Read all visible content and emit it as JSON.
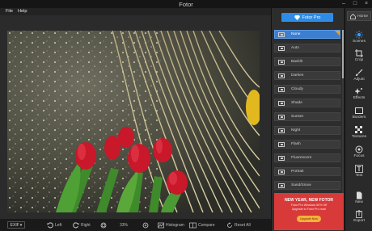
{
  "window": {
    "title": "Fotor",
    "controls": {
      "minimize": "–",
      "maximize": "□",
      "close": "×"
    }
  },
  "menu": {
    "file": "File",
    "help": "Help"
  },
  "bottom_bar": {
    "exif": "EXIF",
    "exif_caret": "▾",
    "left": "Left",
    "right": "Right",
    "zoom": "33%",
    "histogram": "Histogram",
    "compare": "Compare",
    "reset_all": "Reset All"
  },
  "panel": {
    "pro_button": "Fotor Pro",
    "scenes": [
      {
        "label": "None",
        "active": true
      },
      {
        "label": "Auto",
        "active": false
      },
      {
        "label": "Backlit",
        "active": false
      },
      {
        "label": "Darken",
        "active": false
      },
      {
        "label": "Cloudy",
        "active": false
      },
      {
        "label": "Shade",
        "active": false
      },
      {
        "label": "Sunset",
        "active": false
      },
      {
        "label": "Night",
        "active": false
      },
      {
        "label": "Flash",
        "active": false
      },
      {
        "label": "Fluorescent",
        "active": false
      },
      {
        "label": "Portrait",
        "active": false
      },
      {
        "label": "Sand/Snow",
        "active": false
      }
    ],
    "ad": {
      "headline": "NEW YEAR, NEW FOTOR",
      "line1": "Fotor Pro Windows 50% Off",
      "line2": "Upgrade to Fotor Pro now!",
      "cta": "Upgrade Now"
    }
  },
  "toolbar": {
    "home": "Home",
    "tools": [
      "Scenes",
      "Crop",
      "Adjust",
      "Effects",
      "Borders",
      "Textures",
      "Focus",
      "Text",
      "New",
      "Export"
    ]
  },
  "colors": {
    "accent": "#2e8ce6",
    "active_scene": "#3c7fd1",
    "ad_red": "#d83a3a"
  }
}
